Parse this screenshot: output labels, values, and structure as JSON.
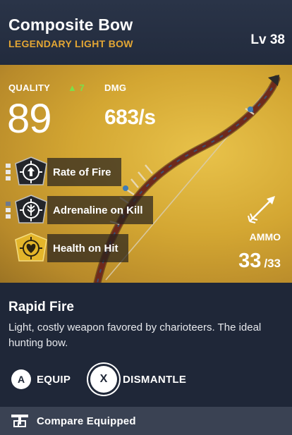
{
  "item": {
    "name": "Composite Bow",
    "rarity_type": "LEGENDARY LIGHT BOW",
    "level": "Lv 38"
  },
  "stats": {
    "quality_label": "QUALITY",
    "quality_delta": "7",
    "quality_value": "89",
    "dmg_label": "DMG",
    "dmg_value": "683/s"
  },
  "perks": [
    {
      "label": "Rate of Fire",
      "icon": "rate-of-fire-icon"
    },
    {
      "label": "Adrenaline on Kill",
      "icon": "adrenaline-icon"
    },
    {
      "label": "Health on Hit",
      "icon": "health-on-hit-icon"
    }
  ],
  "ammo": {
    "label": "AMMO",
    "current": "33",
    "max": "/33"
  },
  "ability": {
    "name": "Rapid Fire",
    "description": "Light, costly weapon favored by charioteers. The ideal hunting bow."
  },
  "actions": {
    "equip_button": "A",
    "equip_label": "EQUIP",
    "dismantle_button": "X",
    "dismantle_label": "DISMANTLE"
  },
  "footer": {
    "compare_label": "Compare Equipped"
  },
  "colors": {
    "rarity": "#e3a634",
    "quality_up": "#7be04a",
    "hero_gold": "#d3a632",
    "panel": "#1e2636"
  }
}
